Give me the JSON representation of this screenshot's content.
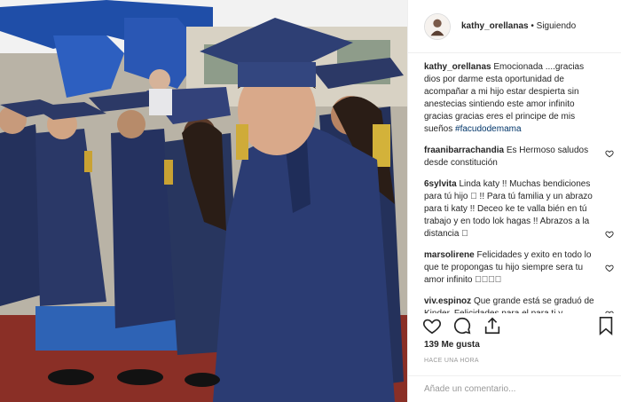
{
  "post": {
    "image_alt": "Graduation photo",
    "author": "kathy_orellanas",
    "follow_status": "• Siguiendo"
  },
  "caption": {
    "author": "kathy_orellanas",
    "text": "Emocionada ....gracias dios por darme esta oportunidad de acompañar a mi hijo estar despierta sin anestecias sintiendo este amor infinito gracias gracias eres el principe de mis sueños",
    "hashtag": "#facudodemama"
  },
  "comments": [
    {
      "author": "fraanibarrachandia",
      "text": "Es Hermoso saludos desde constitución"
    },
    {
      "author": "6sylvita",
      "text": "Linda katy !! Muchas bendiciones para tú hijo 🏻 !! Para tú familia y un abrazo para ti katy !! Deceo ke te valla bién en tú trabajo y en todo lok hagas !! Abrazos a la distancia 🏻"
    },
    {
      "author": "marsolirene",
      "text": "Felicidades y exito en todo lo que te propongas tu hijo siempre sera tu amor infinito 🏻🏻🏻🏻"
    },
    {
      "author": "viv.espinoz",
      "text": "Que grande está se graduó de Kinder. Felicidades para el para ti y"
    }
  ],
  "likes": "139 Me gusta",
  "timestamp": "HACE UNA HORA",
  "add_comment_placeholder": "Añade un comentario...",
  "colors": {
    "link": "#003569",
    "gown": "#26335e",
    "muted": "#999999"
  }
}
